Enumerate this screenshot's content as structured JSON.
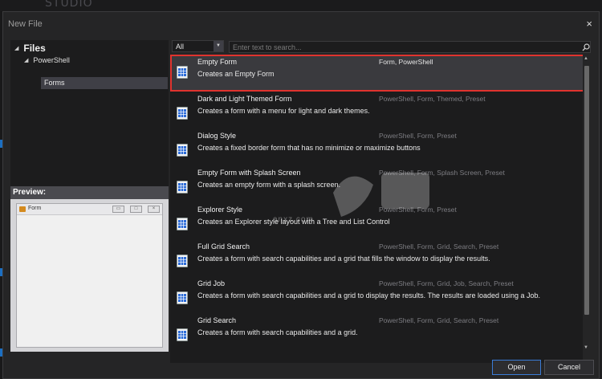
{
  "background": {
    "logo_text": "STUDIO",
    "accent_color": "#1c6fc2"
  },
  "dialog": {
    "title": "New File",
    "close_glyph": "×"
  },
  "tree": {
    "root_label": "Files",
    "child_label": "PowerShell",
    "selected_label": "Forms"
  },
  "preview": {
    "header": "Preview:",
    "window_title": "Form"
  },
  "filter": {
    "value": "All"
  },
  "search": {
    "placeholder": "Enter text to search..."
  },
  "templates": [
    {
      "title": "Empty Form",
      "description": "Creates an Empty Form",
      "tags": "Form, PowerShell",
      "selected": true
    },
    {
      "title": "Dark and Light Themed Form",
      "description": "Creates a form with a menu for light and dark themes.",
      "tags": "PowerShell, Form, Themed, Preset"
    },
    {
      "title": "Dialog Style",
      "description": "Creates a fixed border form that has no minimize or maximize buttons",
      "tags": "PowerShell, Form, Preset"
    },
    {
      "title": "Empty Form with Splash Screen",
      "description": "Creates an empty form with a splash screen.",
      "tags": "PowerShell, Form, Splash Screen, Preset"
    },
    {
      "title": "Explorer Style",
      "description": "Creates an Explorer style layout with a Tree and List Control",
      "tags": "PowerShell, Form, Preset"
    },
    {
      "title": "Full Grid Search",
      "description": "Creates a form with search capabilities and a grid that fills the window to display the results.",
      "tags": "PowerShell, Form, Grid, Search, Preset"
    },
    {
      "title": "Grid Job",
      "description": "Creates a form with search capabilities and a grid to display the results. The results are loaded using a Job.",
      "tags": "PowerShell, Form, Grid, Job, Search, Preset"
    },
    {
      "title": "Grid Search",
      "description": "Creates a form with search capabilities and a grid.",
      "tags": "PowerShell, Form, Grid, Search, Preset"
    }
  ],
  "buttons": {
    "open": "Open",
    "cancel": "Cancel"
  },
  "watermark": {
    "text": "anxz.com"
  },
  "colors": {
    "selection_border": "#e0332e",
    "primary_button_border": "#3a7bd5",
    "icon_blue": "#2b6bd8"
  }
}
